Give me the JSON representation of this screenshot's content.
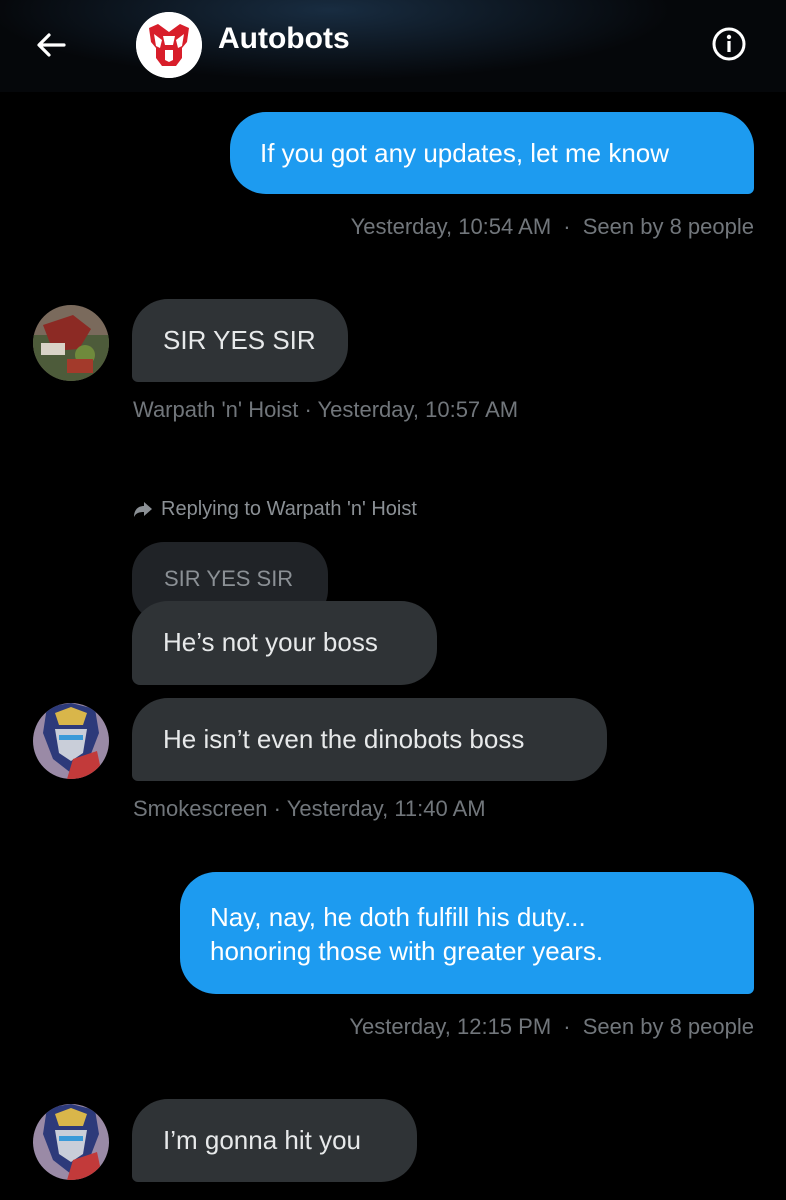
{
  "header": {
    "title": "Autobots",
    "back_icon": "arrow-left-icon",
    "info_icon": "info-icon",
    "logo": "autobot-insignia"
  },
  "colors": {
    "outgoing_bubble": "#1d9bf0",
    "incoming_bubble": "#2f3336",
    "muted_text": "#71767b",
    "background": "#000000"
  },
  "messages": {
    "m1": {
      "text": "If you got any updates, let me know",
      "time": "Yesterday, 10:54 AM",
      "seen": "Seen by 8 people"
    },
    "m2": {
      "text": "SIR YES SIR",
      "sender": "Warpath 'n' Hoist",
      "time": "Yesterday, 10:57 AM"
    },
    "reply": {
      "label": "Replying to Warpath 'n' Hoist",
      "quoted": "SIR YES SIR"
    },
    "m3": {
      "text": "He’s not your boss"
    },
    "m4": {
      "text": "He isn’t even the dinobots boss",
      "sender": "Smokescreen",
      "time": "Yesterday, 11:40 AM"
    },
    "m5": {
      "line1": "Nay, nay, he doth fulfill his duty...",
      "line2": "honoring those with greater years.",
      "time": "Yesterday, 12:15 PM",
      "seen": "Seen by 8 people"
    },
    "m6": {
      "text": "I’m gonna hit you"
    }
  },
  "separator": "·"
}
